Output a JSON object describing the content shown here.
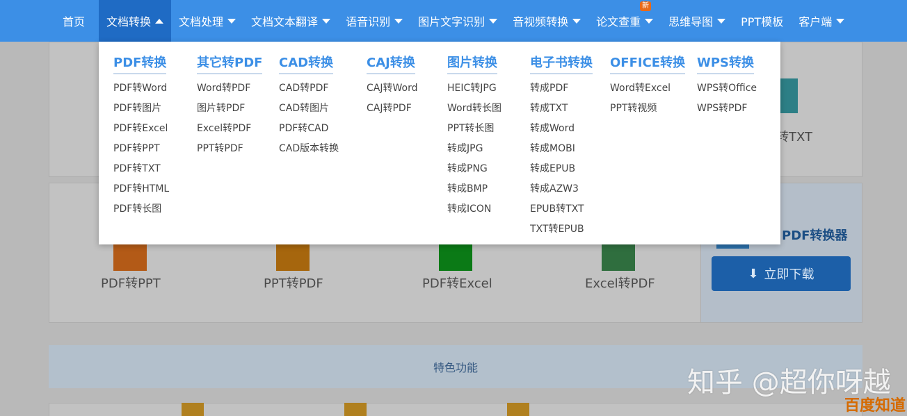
{
  "nav": {
    "items": [
      {
        "label": "首页",
        "caret": "none"
      },
      {
        "label": "文档转换",
        "caret": "up"
      },
      {
        "label": "文档处理",
        "caret": "down"
      },
      {
        "label": "文档文本翻译",
        "caret": "down"
      },
      {
        "label": "语音识别",
        "caret": "down"
      },
      {
        "label": "图片文字识别",
        "caret": "down"
      },
      {
        "label": "音视频转换",
        "caret": "down"
      },
      {
        "label": "论文查重",
        "caret": "down"
      },
      {
        "label": "思维导图",
        "caret": "down"
      },
      {
        "label": "PPT模板",
        "caret": "none"
      },
      {
        "label": "客户端",
        "caret": "down"
      }
    ],
    "badge_new": "新"
  },
  "dropdown": {
    "columns": [
      {
        "head": "PDF转换",
        "items": [
          "PDF转Word",
          "PDF转图片",
          "PDF转Excel",
          "PDF转PPT",
          "PDF转TXT",
          "PDF转HTML",
          "PDF转长图"
        ]
      },
      {
        "head": "其它转PDF",
        "items": [
          "Word转PDF",
          "图片转PDF",
          "Excel转PDF",
          "PPT转PDF"
        ]
      },
      {
        "head": "CAD转换",
        "items": [
          "CAD转PDF",
          "CAD转图片",
          "PDF转CAD",
          "CAD版本转换"
        ]
      },
      {
        "head": "CAJ转换",
        "items": [
          "CAJ转Word",
          "CAJ转PDF"
        ]
      },
      {
        "head": "图片转换",
        "items": [
          "HEIC转JPG",
          "Word转长图",
          "PPT转长图",
          "转成JPG",
          "转成PNG",
          "转成BMP",
          "转成ICON"
        ]
      },
      {
        "head": "电子书转换",
        "items": [
          "转成PDF",
          "转成TXT",
          "转成Word",
          "转成MOBI",
          "转成EPUB",
          "转成AZW3",
          "EPUB转TXT",
          "TXT转EPUB"
        ]
      },
      {
        "head": "OFFICE转换",
        "items": [
          "Word转Excel",
          "PPT转视频"
        ]
      },
      {
        "head": "WPS转换",
        "items": [
          "WPS转Office",
          "WPS转PDF"
        ]
      }
    ]
  },
  "background": {
    "top_right_label": "转TXT",
    "tools": [
      "PDF转PPT",
      "PPT转PDF",
      "PDF转Excel",
      "Excel转PDF"
    ],
    "converter_title": "PDF转换器",
    "download_label": "立即下载",
    "feature_label": "特色功能",
    "colors": {
      "ppt": "#b35a17",
      "pdf": "#a6660d",
      "excel": "#0b7a16",
      "xls": "#2f6e3e",
      "teal": "#2d7f86"
    }
  },
  "watermark": {
    "zhihu": "知乎 @超你呀越",
    "baidu": "百度知道"
  }
}
